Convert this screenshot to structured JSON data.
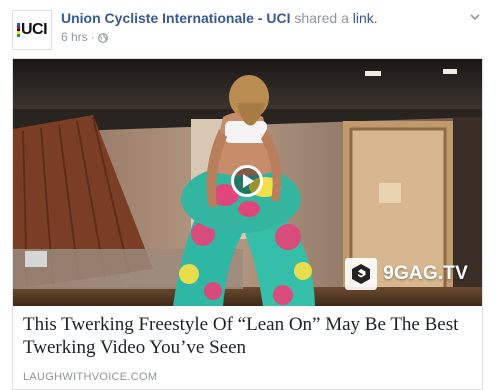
{
  "post": {
    "page_name": "Union Cycliste Internationale - UCI",
    "shared_text": "shared a",
    "link_word": "link.",
    "timestamp": "6 hrs",
    "separator": "·",
    "avatar_text": "UCI",
    "privacy_icon": "globe-icon",
    "options_icon": "chevron-down-icon"
  },
  "card": {
    "title": "This Twerking Freestyle Of “Lean On” May Be The Best Twerking Video You’ve Seen",
    "domain": "LAUGHWITHVOICE.COM",
    "watermark": "9GAG.TV",
    "play_icon": "play-icon"
  },
  "colors": {
    "link_blue": "#365899",
    "meta_gray": "#90949c",
    "border": "#dddfe2",
    "title_text": "#1d2129",
    "uci_stripes": [
      "#0072bb",
      "#e2001a",
      "#000000",
      "#ffde00",
      "#00a651"
    ]
  }
}
